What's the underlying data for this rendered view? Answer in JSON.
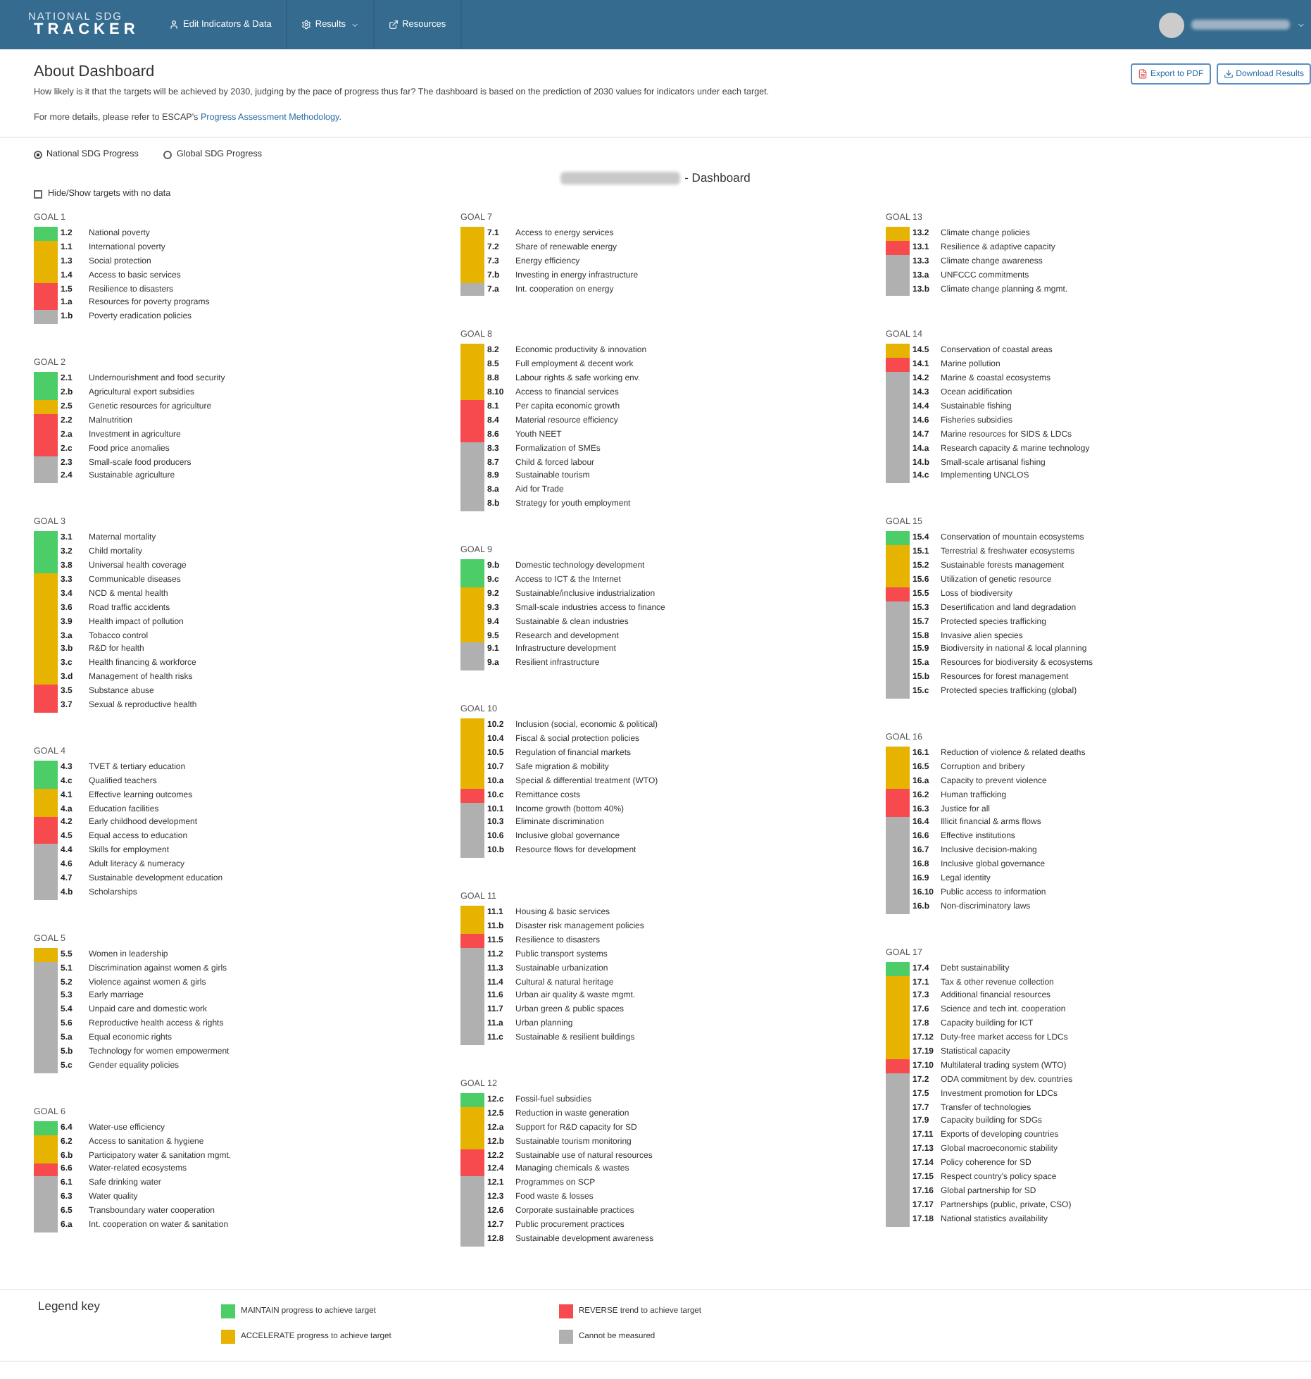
{
  "navbar": {
    "logo_top": "NATIONAL SDG",
    "logo_bottom": "TRACKER",
    "items": [
      {
        "label": "Edit Indicators & Data",
        "dropdown": false
      },
      {
        "label": "Results",
        "dropdown": true
      },
      {
        "label": "Resources",
        "dropdown": false
      }
    ]
  },
  "about": {
    "title": "About Dashboard",
    "description": "How likely is it that the targets will be achieved by 2030, judging by the pace of progress thus far? The dashboard is based on the prediction of 2030 values for indicators under each target.",
    "details_prefix": "For more details, please refer to ESCAP's ",
    "details_link": "Progress Assessment Methodology",
    "details_suffix": "."
  },
  "actions": [
    "Export to PDF",
    "Download Results"
  ],
  "progress_options": [
    {
      "label": "National SDG Progress",
      "selected": true
    },
    {
      "label": "Global SDG Progress",
      "selected": false
    }
  ],
  "dashboard_title": "- Dashboard",
  "hide_targets": {
    "label": "Hide/Show targets with no data",
    "checked": false
  },
  "columns": [
    {
      "goals": [
        {
          "title": "GOAL 1",
          "targets": [
            {
              "code": "1.2",
              "name": "National poverty",
              "color": "#4ccd68"
            },
            {
              "code": "1.1",
              "name": "International poverty",
              "color": "#e5b300"
            },
            {
              "code": "1.3",
              "name": "Social protection",
              "color": "#e5b300"
            },
            {
              "code": "1.4",
              "name": "Access to basic services",
              "color": "#e5b300"
            },
            {
              "code": "1.5",
              "name": "Resilience to disasters",
              "color": "#f64a4f"
            },
            {
              "code": "1.a",
              "name": "Resources for poverty programs",
              "color": "#f64a4f"
            },
            {
              "code": "1.b",
              "name": "Poverty eradication policies",
              "color": "#b0b0b0"
            }
          ]
        },
        {
          "title": "GOAL 2",
          "targets": [
            {
              "code": "2.1",
              "name": "Undernourishment and food security",
              "color": "#4ccd68"
            },
            {
              "code": "2.b",
              "name": "Agricultural export subsidies",
              "color": "#4ccd68"
            },
            {
              "code": "2.5",
              "name": "Genetic resources for agriculture",
              "color": "#e5b300"
            },
            {
              "code": "2.2",
              "name": "Malnutrition",
              "color": "#f64a4f"
            },
            {
              "code": "2.a",
              "name": "Investment in agriculture",
              "color": "#f64a4f"
            },
            {
              "code": "2.c",
              "name": "Food price anomalies",
              "color": "#f64a4f"
            },
            {
              "code": "2.3",
              "name": "Small-scale food producers",
              "color": "#b0b0b0"
            },
            {
              "code": "2.4",
              "name": "Sustainable agriculture",
              "color": "#b0b0b0"
            }
          ]
        },
        {
          "title": "GOAL 3",
          "targets": [
            {
              "code": "3.1",
              "name": "Maternal mortality",
              "color": "#4ccd68"
            },
            {
              "code": "3.2",
              "name": "Child mortality",
              "color": "#4ccd68"
            },
            {
              "code": "3.8",
              "name": "Universal health coverage",
              "color": "#4ccd68"
            },
            {
              "code": "3.3",
              "name": "Communicable diseases",
              "color": "#e5b300"
            },
            {
              "code": "3.4",
              "name": "NCD & mental health",
              "color": "#e5b300"
            },
            {
              "code": "3.6",
              "name": "Road traffic accidents",
              "color": "#e5b300"
            },
            {
              "code": "3.9",
              "name": "Health impact of pollution",
              "color": "#e5b300"
            },
            {
              "code": "3.a",
              "name": "Tobacco control",
              "color": "#e5b300"
            },
            {
              "code": "3.b",
              "name": "R&D for health",
              "color": "#e5b300"
            },
            {
              "code": "3.c",
              "name": "Health financing & workforce",
              "color": "#e5b300"
            },
            {
              "code": "3.d",
              "name": "Management of health risks",
              "color": "#e5b300"
            },
            {
              "code": "3.5",
              "name": "Substance abuse",
              "color": "#f64a4f"
            },
            {
              "code": "3.7",
              "name": "Sexual & reproductive health",
              "color": "#f64a4f"
            }
          ]
        },
        {
          "title": "GOAL 4",
          "targets": [
            {
              "code": "4.3",
              "name": "TVET & tertiary education",
              "color": "#4ccd68"
            },
            {
              "code": "4.c",
              "name": "Qualified teachers",
              "color": "#4ccd68"
            },
            {
              "code": "4.1",
              "name": "Effective learning outcomes",
              "color": "#e5b300"
            },
            {
              "code": "4.a",
              "name": "Education facilities",
              "color": "#e5b300"
            },
            {
              "code": "4.2",
              "name": "Early childhood development",
              "color": "#f64a4f"
            },
            {
              "code": "4.5",
              "name": "Equal access to education",
              "color": "#f64a4f"
            },
            {
              "code": "4.4",
              "name": "Skills for employment",
              "color": "#b0b0b0"
            },
            {
              "code": "4.6",
              "name": "Adult literacy & numeracy",
              "color": "#b0b0b0"
            },
            {
              "code": "4.7",
              "name": "Sustainable development education",
              "color": "#b0b0b0"
            },
            {
              "code": "4.b",
              "name": "Scholarships",
              "color": "#b0b0b0"
            }
          ]
        },
        {
          "title": "GOAL 5",
          "targets": [
            {
              "code": "5.5",
              "name": "Women in leadership",
              "color": "#e5b300"
            },
            {
              "code": "5.1",
              "name": "Discrimination against women & girls",
              "color": "#b0b0b0"
            },
            {
              "code": "5.2",
              "name": "Violence against women & girls",
              "color": "#b0b0b0"
            },
            {
              "code": "5.3",
              "name": "Early marriage",
              "color": "#b0b0b0"
            },
            {
              "code": "5.4",
              "name": "Unpaid care and domestic work",
              "color": "#b0b0b0"
            },
            {
              "code": "5.6",
              "name": "Reproductive health access & rights",
              "color": "#b0b0b0"
            },
            {
              "code": "5.a",
              "name": "Equal economic rights",
              "color": "#b0b0b0"
            },
            {
              "code": "5.b",
              "name": "Technology for women empowerment",
              "color": "#b0b0b0"
            },
            {
              "code": "5.c",
              "name": "Gender equality policies",
              "color": "#b0b0b0"
            }
          ]
        },
        {
          "title": "GOAL 6",
          "targets": [
            {
              "code": "6.4",
              "name": "Water-use efficiency",
              "color": "#4ccd68"
            },
            {
              "code": "6.2",
              "name": "Access to sanitation & hygiene",
              "color": "#e5b300"
            },
            {
              "code": "6.b",
              "name": "Participatory water & sanitation mgmt.",
              "color": "#e5b300"
            },
            {
              "code": "6.6",
              "name": "Water-related ecosystems",
              "color": "#f64a4f"
            },
            {
              "code": "6.1",
              "name": "Safe drinking water",
              "color": "#b0b0b0"
            },
            {
              "code": "6.3",
              "name": "Water quality",
              "color": "#b0b0b0"
            },
            {
              "code": "6.5",
              "name": "Transboundary water cooperation",
              "color": "#b0b0b0"
            },
            {
              "code": "6.a",
              "name": "Int. cooperation on water & sanitation",
              "color": "#b0b0b0"
            }
          ]
        }
      ]
    },
    {
      "goals": [
        {
          "title": "GOAL 7",
          "targets": [
            {
              "code": "7.1",
              "name": "Access to energy services",
              "color": "#e5b300"
            },
            {
              "code": "7.2",
              "name": "Share of renewable energy",
              "color": "#e5b300"
            },
            {
              "code": "7.3",
              "name": "Energy efficiency",
              "color": "#e5b300"
            },
            {
              "code": "7.b",
              "name": "Investing in energy infrastructure",
              "color": "#e5b300"
            },
            {
              "code": "7.a",
              "name": "Int. cooperation on energy",
              "color": "#b0b0b0"
            }
          ]
        },
        {
          "title": "GOAL 8",
          "targets": [
            {
              "code": "8.2",
              "name": "Economic productivity & innovation",
              "color": "#e5b300"
            },
            {
              "code": "8.5",
              "name": "Full employment & decent work",
              "color": "#e5b300"
            },
            {
              "code": "8.8",
              "name": "Labour rights & safe working env.",
              "color": "#e5b300"
            },
            {
              "code": "8.10",
              "name": "Access to financial services",
              "color": "#e5b300"
            },
            {
              "code": "8.1",
              "name": "Per capita economic growth",
              "color": "#f64a4f"
            },
            {
              "code": "8.4",
              "name": "Material resource efficiency",
              "color": "#f64a4f"
            },
            {
              "code": "8.6",
              "name": "Youth NEET",
              "color": "#f64a4f"
            },
            {
              "code": "8.3",
              "name": "Formalization of SMEs",
              "color": "#b0b0b0"
            },
            {
              "code": "8.7",
              "name": "Child & forced labour",
              "color": "#b0b0b0"
            },
            {
              "code": "8.9",
              "name": "Sustainable tourism",
              "color": "#b0b0b0"
            },
            {
              "code": "8.a",
              "name": "Aid for Trade",
              "color": "#b0b0b0"
            },
            {
              "code": "8.b",
              "name": "Strategy for youth employment",
              "color": "#b0b0b0"
            }
          ]
        },
        {
          "title": "GOAL 9",
          "targets": [
            {
              "code": "9.b",
              "name": "Domestic technology development",
              "color": "#4ccd68"
            },
            {
              "code": "9.c",
              "name": "Access to ICT & the Internet",
              "color": "#4ccd68"
            },
            {
              "code": "9.2",
              "name": "Sustainable/inclusive industrialization",
              "color": "#e5b300"
            },
            {
              "code": "9.3",
              "name": "Small-scale industries access to finance",
              "color": "#e5b300"
            },
            {
              "code": "9.4",
              "name": "Sustainable & clean industries",
              "color": "#e5b300"
            },
            {
              "code": "9.5",
              "name": "Research and development",
              "color": "#e5b300"
            },
            {
              "code": "9.1",
              "name": "Infrastructure development",
              "color": "#b0b0b0"
            },
            {
              "code": "9.a",
              "name": "Resilient infrastructure",
              "color": "#b0b0b0"
            }
          ]
        },
        {
          "title": "GOAL 10",
          "targets": [
            {
              "code": "10.2",
              "name": "Inclusion (social, economic & political)",
              "color": "#e5b300"
            },
            {
              "code": "10.4",
              "name": "Fiscal & social protection policies",
              "color": "#e5b300"
            },
            {
              "code": "10.5",
              "name": "Regulation of financial markets",
              "color": "#e5b300"
            },
            {
              "code": "10.7",
              "name": "Safe migration & mobility",
              "color": "#e5b300"
            },
            {
              "code": "10.a",
              "name": "Special & differential treatment (WTO)",
              "color": "#e5b300"
            },
            {
              "code": "10.c",
              "name": "Remittance costs",
              "color": "#f64a4f"
            },
            {
              "code": "10.1",
              "name": "Income growth (bottom 40%)",
              "color": "#b0b0b0"
            },
            {
              "code": "10.3",
              "name": "Eliminate discrimination",
              "color": "#b0b0b0"
            },
            {
              "code": "10.6",
              "name": "Inclusive global governance",
              "color": "#b0b0b0"
            },
            {
              "code": "10.b",
              "name": "Resource flows for development",
              "color": "#b0b0b0"
            }
          ]
        },
        {
          "title": "GOAL 11",
          "targets": [
            {
              "code": "11.1",
              "name": "Housing & basic services",
              "color": "#e5b300"
            },
            {
              "code": "11.b",
              "name": "Disaster risk management policies",
              "color": "#e5b300"
            },
            {
              "code": "11.5",
              "name": "Resilience to disasters",
              "color": "#f64a4f"
            },
            {
              "code": "11.2",
              "name": "Public transport systems",
              "color": "#b0b0b0"
            },
            {
              "code": "11.3",
              "name": "Sustainable urbanization",
              "color": "#b0b0b0"
            },
            {
              "code": "11.4",
              "name": "Cultural & natural heritage",
              "color": "#b0b0b0"
            },
            {
              "code": "11.6",
              "name": "Urban air quality & waste mgmt.",
              "color": "#b0b0b0"
            },
            {
              "code": "11.7",
              "name": "Urban green & public spaces",
              "color": "#b0b0b0"
            },
            {
              "code": "11.a",
              "name": "Urban planning",
              "color": "#b0b0b0"
            },
            {
              "code": "11.c",
              "name": "Sustainable & resilient buildings",
              "color": "#b0b0b0"
            }
          ]
        },
        {
          "title": "GOAL 12",
          "targets": [
            {
              "code": "12.c",
              "name": "Fossil-fuel subsidies",
              "color": "#4ccd68"
            },
            {
              "code": "12.5",
              "name": "Reduction in waste generation",
              "color": "#e5b300"
            },
            {
              "code": "12.a",
              "name": "Support for R&D capacity for SD",
              "color": "#e5b300"
            },
            {
              "code": "12.b",
              "name": "Sustainable tourism monitoring",
              "color": "#e5b300"
            },
            {
              "code": "12.2",
              "name": "Sustainable use of natural resources",
              "color": "#f64a4f"
            },
            {
              "code": "12.4",
              "name": "Managing chemicals & wastes",
              "color": "#f64a4f"
            },
            {
              "code": "12.1",
              "name": "Programmes on SCP",
              "color": "#b0b0b0"
            },
            {
              "code": "12.3",
              "name": "Food waste & losses",
              "color": "#b0b0b0"
            },
            {
              "code": "12.6",
              "name": "Corporate sustainable practices",
              "color": "#b0b0b0"
            },
            {
              "code": "12.7",
              "name": "Public procurement practices",
              "color": "#b0b0b0"
            },
            {
              "code": "12.8",
              "name": "Sustainable development awareness",
              "color": "#b0b0b0"
            }
          ]
        }
      ]
    },
    {
      "goals": [
        {
          "title": "GOAL 13",
          "targets": [
            {
              "code": "13.2",
              "name": "Climate change policies",
              "color": "#e5b300"
            },
            {
              "code": "13.1",
              "name": "Resilience & adaptive capacity",
              "color": "#f64a4f"
            },
            {
              "code": "13.3",
              "name": "Climate change awareness",
              "color": "#b0b0b0"
            },
            {
              "code": "13.a",
              "name": "UNFCCC commitments",
              "color": "#b0b0b0"
            },
            {
              "code": "13.b",
              "name": "Climate change planning & mgmt.",
              "color": "#b0b0b0"
            }
          ]
        },
        {
          "title": "GOAL 14",
          "targets": [
            {
              "code": "14.5",
              "name": "Conservation of coastal areas",
              "color": "#e5b300"
            },
            {
              "code": "14.1",
              "name": "Marine pollution",
              "color": "#f64a4f"
            },
            {
              "code": "14.2",
              "name": "Marine & coastal ecosystems",
              "color": "#b0b0b0"
            },
            {
              "code": "14.3",
              "name": "Ocean acidification",
              "color": "#b0b0b0"
            },
            {
              "code": "14.4",
              "name": "Sustainable fishing",
              "color": "#b0b0b0"
            },
            {
              "code": "14.6",
              "name": "Fisheries subsidies",
              "color": "#b0b0b0"
            },
            {
              "code": "14.7",
              "name": "Marine resources for SIDS & LDCs",
              "color": "#b0b0b0"
            },
            {
              "code": "14.a",
              "name": "Research capacity & marine technology",
              "color": "#b0b0b0"
            },
            {
              "code": "14.b",
              "name": "Small-scale artisanal fishing",
              "color": "#b0b0b0"
            },
            {
              "code": "14.c",
              "name": "Implementing UNCLOS",
              "color": "#b0b0b0"
            }
          ]
        },
        {
          "title": "GOAL 15",
          "targets": [
            {
              "code": "15.4",
              "name": "Conservation of mountain ecosystems",
              "color": "#4ccd68"
            },
            {
              "code": "15.1",
              "name": "Terrestrial & freshwater ecosystems",
              "color": "#e5b300"
            },
            {
              "code": "15.2",
              "name": "Sustainable forests management",
              "color": "#e5b300"
            },
            {
              "code": "15.6",
              "name": "Utilization of genetic resource",
              "color": "#e5b300"
            },
            {
              "code": "15.5",
              "name": "Loss of biodiversity",
              "color": "#f64a4f"
            },
            {
              "code": "15.3",
              "name": "Desertification and land degradation",
              "color": "#b0b0b0"
            },
            {
              "code": "15.7",
              "name": "Protected species trafficking",
              "color": "#b0b0b0"
            },
            {
              "code": "15.8",
              "name": "Invasive alien species",
              "color": "#b0b0b0"
            },
            {
              "code": "15.9",
              "name": "Biodiversity in national & local planning",
              "color": "#b0b0b0"
            },
            {
              "code": "15.a",
              "name": "Resources for biodiversity & ecosystems",
              "color": "#b0b0b0"
            },
            {
              "code": "15.b",
              "name": "Resources for forest management",
              "color": "#b0b0b0"
            },
            {
              "code": "15.c",
              "name": "Protected species trafficking (global)",
              "color": "#b0b0b0"
            }
          ]
        },
        {
          "title": "GOAL 16",
          "targets": [
            {
              "code": "16.1",
              "name": "Reduction of violence & related deaths",
              "color": "#e5b300"
            },
            {
              "code": "16.5",
              "name": "Corruption and bribery",
              "color": "#e5b300"
            },
            {
              "code": "16.a",
              "name": "Capacity to prevent violence",
              "color": "#e5b300"
            },
            {
              "code": "16.2",
              "name": "Human trafficking",
              "color": "#f64a4f"
            },
            {
              "code": "16.3",
              "name": "Justice for all",
              "color": "#f64a4f"
            },
            {
              "code": "16.4",
              "name": "Illicit financial & arms flows",
              "color": "#b0b0b0"
            },
            {
              "code": "16.6",
              "name": "Effective institutions",
              "color": "#b0b0b0"
            },
            {
              "code": "16.7",
              "name": "Inclusive decision-making",
              "color": "#b0b0b0"
            },
            {
              "code": "16.8",
              "name": "Inclusive global governance",
              "color": "#b0b0b0"
            },
            {
              "code": "16.9",
              "name": "Legal identity",
              "color": "#b0b0b0"
            },
            {
              "code": "16.10",
              "name": "Public access to information",
              "color": "#b0b0b0"
            },
            {
              "code": "16.b",
              "name": "Non-discriminatory laws",
              "color": "#b0b0b0"
            }
          ]
        },
        {
          "title": "GOAL 17",
          "targets": [
            {
              "code": "17.4",
              "name": "Debt sustainability",
              "color": "#4ccd68"
            },
            {
              "code": "17.1",
              "name": "Tax & other revenue collection",
              "color": "#e5b300"
            },
            {
              "code": "17.3",
              "name": "Additional financial resources",
              "color": "#e5b300"
            },
            {
              "code": "17.6",
              "name": "Science and tech int. cooperation",
              "color": "#e5b300"
            },
            {
              "code": "17.8",
              "name": "Capacity building for ICT",
              "color": "#e5b300"
            },
            {
              "code": "17.12",
              "name": "Duty-free market access for LDCs",
              "color": "#e5b300"
            },
            {
              "code": "17.19",
              "name": "Statistical capacity",
              "color": "#e5b300"
            },
            {
              "code": "17.10",
              "name": "Multilateral trading system (WTO)",
              "color": "#f64a4f"
            },
            {
              "code": "17.2",
              "name": "ODA commitment by dev. countries",
              "color": "#b0b0b0"
            },
            {
              "code": "17.5",
              "name": "Investment promotion for LDCs",
              "color": "#b0b0b0"
            },
            {
              "code": "17.7",
              "name": "Transfer of technologies",
              "color": "#b0b0b0"
            },
            {
              "code": "17.9",
              "name": "Capacity building for SDGs",
              "color": "#b0b0b0"
            },
            {
              "code": "17.11",
              "name": "Exports of developing countries",
              "color": "#b0b0b0"
            },
            {
              "code": "17.13",
              "name": "Global macroeconomic stability",
              "color": "#b0b0b0"
            },
            {
              "code": "17.14",
              "name": "Policy coherence for SD",
              "color": "#b0b0b0"
            },
            {
              "code": "17.15",
              "name": "Respect country's policy space",
              "color": "#b0b0b0"
            },
            {
              "code": "17.16",
              "name": "Global partnership for SD",
              "color": "#b0b0b0"
            },
            {
              "code": "17.17",
              "name": "Partnerships (public, private, CSO)",
              "color": "#b0b0b0"
            },
            {
              "code": "17.18",
              "name": "National statistics availability",
              "color": "#b0b0b0"
            }
          ]
        }
      ]
    }
  ],
  "legend": {
    "title": "Legend key",
    "items": [
      {
        "label": "MAINTAIN progress to achieve target",
        "color": "#4ccd68"
      },
      {
        "label": "REVERSE trend to achieve target",
        "color": "#f64a4f"
      },
      {
        "label": "ACCELERATE progress to achieve target",
        "color": "#e5b300"
      },
      {
        "label": "Cannot be measured",
        "color": "#b0b0b0"
      }
    ]
  }
}
